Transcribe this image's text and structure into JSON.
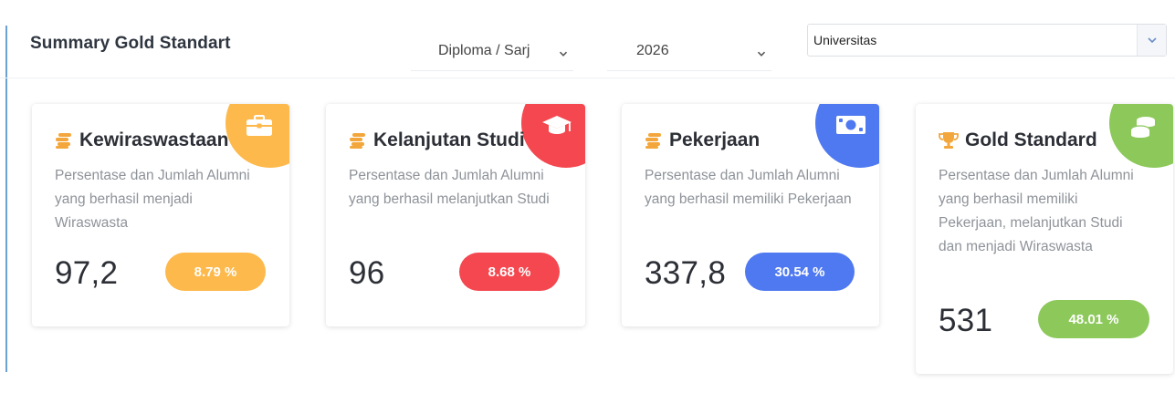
{
  "header": {
    "title": "Summary Gold Standart",
    "degree_select": "Diploma / Sarj",
    "year_select": "2026",
    "scope_select": "Universitas"
  },
  "colors": {
    "orange": "#fdb94b",
    "red": "#f4474f",
    "blue": "#4f79f0",
    "green": "#8cc85a"
  },
  "cards": [
    {
      "title": "Kewiraswastaan",
      "title_icon": "coins-icon",
      "corner_icon": "briefcase-icon",
      "description": "Persentase dan Jumlah Alumni yang berhasil menjadi Wiraswasta",
      "value": "97,2",
      "percent": "8.79 %"
    },
    {
      "title": "Kelanjutan Studi",
      "title_icon": "coins-icon",
      "corner_icon": "graduation-cap-icon",
      "description": "Persentase dan Jumlah Alumni yang berhasil melanjutkan Studi",
      "value": "96",
      "percent": "8.68 %"
    },
    {
      "title": "Pekerjaan",
      "title_icon": "coins-icon",
      "corner_icon": "money-bill-icon",
      "description": "Persentase dan Jumlah Alumni yang berhasil memiliki Pekerjaan",
      "value": "337,8",
      "percent": "30.54 %"
    },
    {
      "title": "Gold Standard",
      "title_icon": "trophy-icon",
      "corner_icon": "coin-stack-icon",
      "description": "Persentase dan Jumlah Alumni yang berhasil memiliki Pekerjaan, melanjutkan Studi dan menjadi Wiraswasta",
      "value": "531",
      "percent": "48.01 %"
    }
  ]
}
